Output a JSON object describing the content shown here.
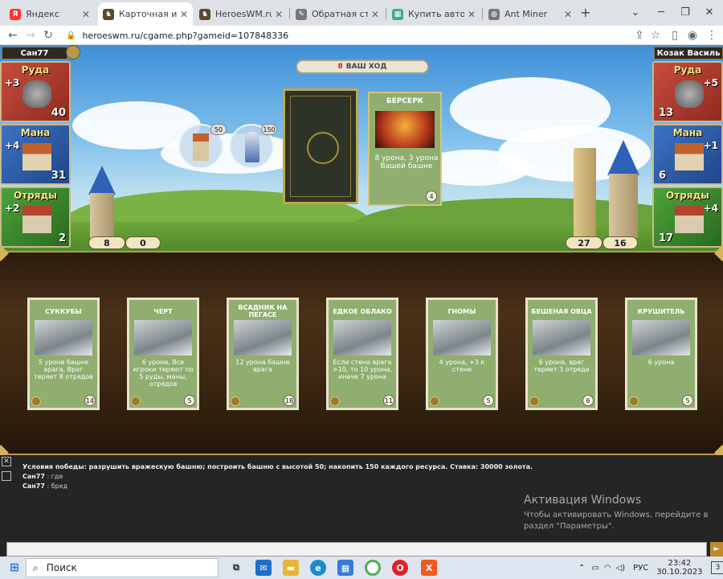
{
  "browser": {
    "tabs": [
      {
        "title": "Яндекс",
        "icon": "yandex-icon",
        "color": "#f33"
      },
      {
        "title": "Карточная игра. Г",
        "icon": "hwm-icon",
        "color": "#5a4a2a"
      },
      {
        "title": "HeroesWM.ru Геро",
        "icon": "hwm-icon",
        "color": "#5a4a2a"
      },
      {
        "title": "Обратная сторон",
        "icon": "tools-icon",
        "color": "#777"
      },
      {
        "title": "Купить авто 🚗 в",
        "icon": "apps-icon",
        "color": "#4a8"
      },
      {
        "title": "Ant Miner",
        "icon": "globe-icon",
        "color": "#777"
      }
    ],
    "new_tab": "+",
    "url": "heroeswm.ru/cgame.php?gameid=107848336"
  },
  "game": {
    "left_player": {
      "name": "Сан77",
      "resources": [
        {
          "label": "Руда",
          "income": "+3",
          "amount": "40",
          "color": "#b23b2f"
        },
        {
          "label": "Мана",
          "income": "+4",
          "amount": "31",
          "color": "#2f5ea8"
        },
        {
          "label": "Отряды",
          "income": "+2",
          "amount": "2",
          "color": "#3d8a2e"
        }
      ],
      "tower": "8",
      "wall": "0"
    },
    "right_player": {
      "name": "Козак Василь",
      "resources": [
        {
          "label": "Руда",
          "income": "+5",
          "amount": "13",
          "color": "#b23b2f"
        },
        {
          "label": "Мана",
          "income": "+1",
          "amount": "6",
          "color": "#2f5ea8"
        },
        {
          "label": "Отряды",
          "income": "+4",
          "amount": "17",
          "color": "#3d8a2e"
        }
      ],
      "tower": "27",
      "wall": "16"
    },
    "turn": {
      "number": "8",
      "text": "ВАШ ХОД"
    },
    "buy_buttons": [
      {
        "name": "buy-tower-button",
        "cost": "50"
      },
      {
        "name": "buy-knight-button",
        "cost": "150"
      }
    ],
    "played_card": {
      "title": "БЕРСЕРК",
      "desc": "8 урона, 3 урона Вашей башне",
      "cost": "4"
    },
    "hand": [
      {
        "title": "СУККУБЫ",
        "desc": "5 урона башне врага, Враг теряет 8 отрядов",
        "cost": "14"
      },
      {
        "title": "ЧЕРТ",
        "desc": "6 урона, Все игроки теряют по 5 руды, маны, отрядов",
        "cost": "5"
      },
      {
        "title": "ВСАДНИК НА ПЕГАСЕ",
        "desc": "12 урона башне врага",
        "cost": "18"
      },
      {
        "title": "ЕДКОЕ ОБЛАКО",
        "desc": "Если стена врага >10, то 10 урона, иначе 7 урона",
        "cost": "11"
      },
      {
        "title": "ГНОМЫ",
        "desc": "4 урона, +3 к стене",
        "cost": "5"
      },
      {
        "title": "БЕШЕНАЯ ОВЦА",
        "desc": "6 урона, враг теряет 3 отряда",
        "cost": "6"
      },
      {
        "title": "КРУШИТЕЛЬ",
        "desc": "6 урона",
        "cost": "5"
      }
    ]
  },
  "chat": {
    "close": "✕",
    "messages": [
      {
        "author": "",
        "text": "Условия победы: разрушить вражескую башню; построить башню с высотой 50; накопить 150 каждого ресурса. Ставка: 30000 золота."
      },
      {
        "author": "Сан77",
        "text": " : где"
      },
      {
        "author": "Сан77",
        "text": " : бред"
      }
    ],
    "activation_title": "Активация Windows",
    "activation_line1": "Чтобы активировать Windows, перейдите в",
    "activation_line2": "раздел \"Параметры\".",
    "send": "►"
  },
  "taskbar": {
    "search_placeholder": "Поиск",
    "lang": "РУС",
    "time": "23:42",
    "date": "30.10.2023",
    "notifications": "3"
  }
}
